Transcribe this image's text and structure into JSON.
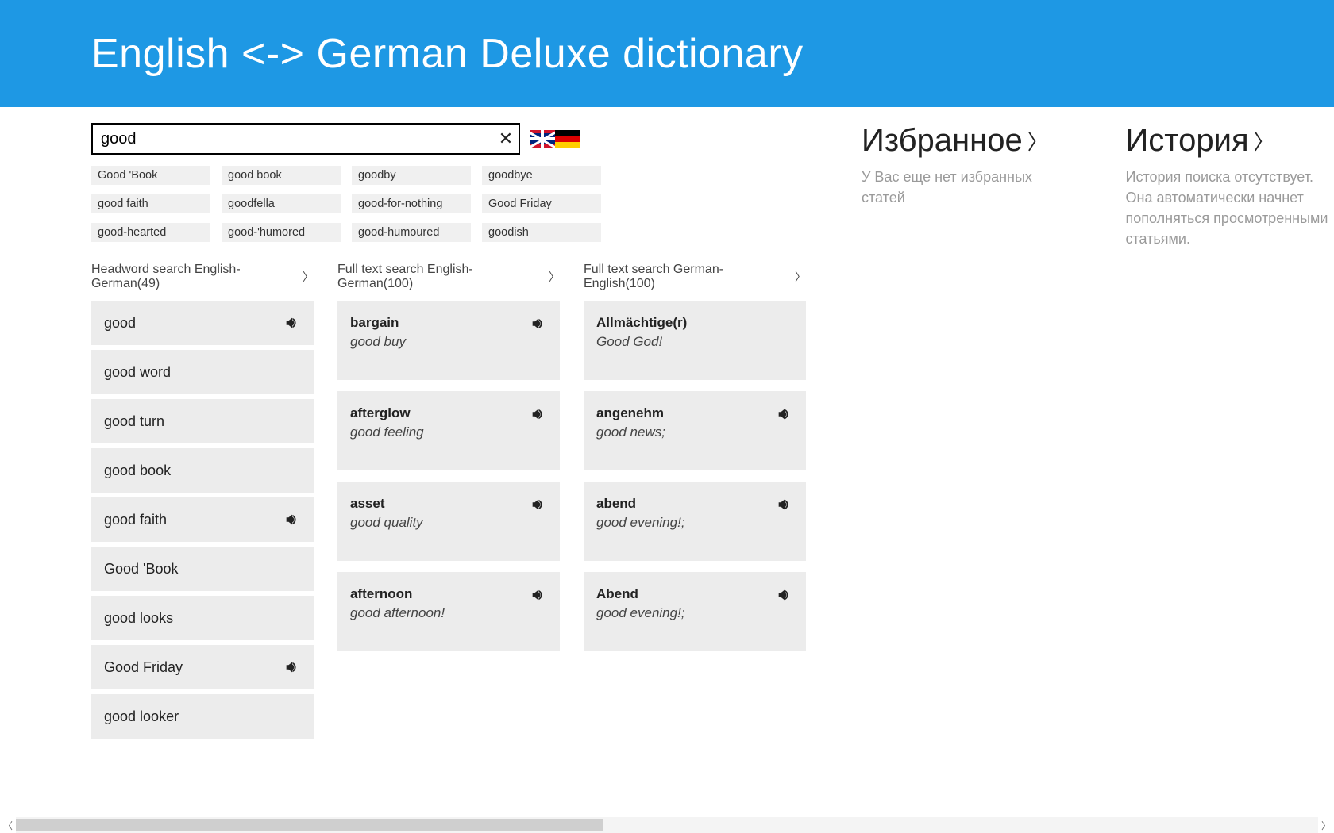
{
  "header": {
    "title": "English <-> German Deluxe dictionary"
  },
  "search": {
    "value": "good",
    "clear_glyph": "✕"
  },
  "suggestions": [
    "Good 'Book",
    "good book",
    "goodby",
    "goodbye",
    "good faith",
    "goodfella",
    "good-for-nothing",
    "Good Friday",
    "good-hearted",
    "good-'humored",
    "good-humoured",
    "goodish"
  ],
  "columns": {
    "headword": {
      "title": "Headword search English-German(49)",
      "items": [
        {
          "term": "good",
          "audio": true
        },
        {
          "term": "good word",
          "audio": false
        },
        {
          "term": "good turn",
          "audio": false
        },
        {
          "term": "good book",
          "audio": false
        },
        {
          "term": "good faith",
          "audio": true
        },
        {
          "term": "Good 'Book",
          "audio": false
        },
        {
          "term": "good looks",
          "audio": false
        },
        {
          "term": "Good Friday",
          "audio": true
        },
        {
          "term": "good looker",
          "audio": false
        }
      ]
    },
    "full_en_de": {
      "title": "Full text search English-German(100)",
      "items": [
        {
          "term": "bargain",
          "def": "good buy",
          "audio": true
        },
        {
          "term": "afterglow",
          "def": "good feeling",
          "audio": true
        },
        {
          "term": "asset",
          "def": "good quality",
          "audio": true
        },
        {
          "term": "afternoon",
          "def": "good afternoon!",
          "audio": true
        }
      ]
    },
    "full_de_en": {
      "title": "Full text search German-English(100)",
      "items": [
        {
          "term": "Allmächtige(r)",
          "def": "Good God!",
          "audio": false
        },
        {
          "term": "angenehm",
          "def": "good news;",
          "audio": true
        },
        {
          "term": "abend",
          "def": "good evening!;",
          "audio": true
        },
        {
          "term": "Abend",
          "def": "good evening!;",
          "audio": true
        }
      ]
    }
  },
  "panels": {
    "favorites": {
      "title": "Избранное",
      "body": "У Вас еще нет избранных статей"
    },
    "history": {
      "title": "История",
      "body": "История поиска отсутствует. Она автоматически начнет пополняться просмотренными статьями."
    }
  }
}
